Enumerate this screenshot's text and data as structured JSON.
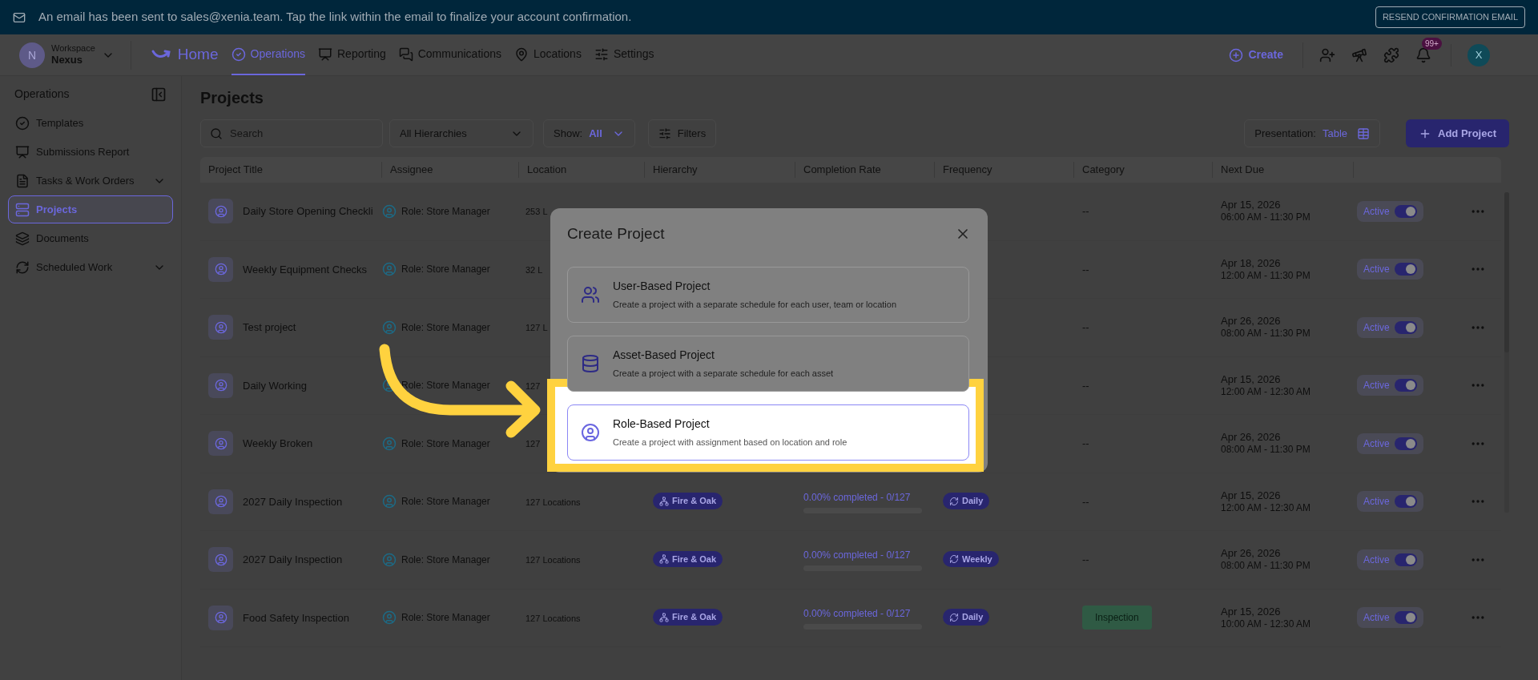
{
  "banner": {
    "message": "An email has been sent to sales@xenia.team. Tap the link within the email to finalize your account confirmation.",
    "button": "RESEND CONFIRMATION EMAIL"
  },
  "nav": {
    "workspace_label": "Workspace",
    "workspace_name": "Nexus",
    "workspace_initial": "N",
    "home": "Home",
    "tabs": [
      {
        "label": "Operations",
        "selected": true
      },
      {
        "label": "Reporting",
        "selected": false
      },
      {
        "label": "Communications",
        "selected": false
      },
      {
        "label": "Locations",
        "selected": false
      },
      {
        "label": "Settings",
        "selected": false
      }
    ],
    "create": "Create",
    "notification_badge": "99+",
    "avatar_initial": "X"
  },
  "sidebar": {
    "title": "Operations",
    "items": [
      {
        "label": "Templates",
        "selected": false,
        "expandable": false
      },
      {
        "label": "Submissions Report",
        "selected": false,
        "expandable": false
      },
      {
        "label": "Tasks & Work Orders",
        "selected": false,
        "expandable": true
      },
      {
        "label": "Projects",
        "selected": true,
        "expandable": false
      },
      {
        "label": "Documents",
        "selected": false,
        "expandable": false
      },
      {
        "label": "Scheduled Work",
        "selected": false,
        "expandable": true
      }
    ]
  },
  "page": {
    "title": "Projects",
    "search_placeholder": "Search",
    "hierarchy_select": "All Hierarchies",
    "show_label": "Show:",
    "show_value": "All",
    "filters": "Filters",
    "presentation_label": "Presentation:",
    "presentation_value": "Table",
    "add_button": "Add Project"
  },
  "table": {
    "columns": [
      "Project Title",
      "Assignee",
      "Location",
      "Hierarchy",
      "Completion Rate",
      "Frequency",
      "Category",
      "Next Due"
    ],
    "rows": [
      {
        "title": "Daily Store Opening Checkli",
        "assignee": "Role: Store Manager",
        "location": "253 L",
        "due_date": "Apr 15, 2026",
        "due_time": "06:00 AM - 11:30 PM",
        "category": {
          "text": "--",
          "kind": "plain"
        },
        "status": "Active",
        "on": true
      },
      {
        "title": "Weekly Equipment Checks",
        "assignee": "Role: Store Manager",
        "location": "32 L",
        "due_date": "Apr 18, 2026",
        "due_time": "12:00 AM - 11:30 PM",
        "category": {
          "text": "--",
          "kind": "plain"
        },
        "status": "Active",
        "on": true
      },
      {
        "title": "Test project",
        "assignee": "Role: Store Manager",
        "location": "127 L",
        "due_date": "Apr 26, 2026",
        "due_time": "08:00 AM - 11:30 PM",
        "category": {
          "text": "--",
          "kind": "plain"
        },
        "status": "Active",
        "on": true
      },
      {
        "title": "Daily Working",
        "assignee": "Role: Store Manager",
        "location": "127",
        "due_date": "Apr 15, 2026",
        "due_time": "12:00 AM - 12:30 AM",
        "category": {
          "text": "--",
          "kind": "plain"
        },
        "status": "Active",
        "on": true
      },
      {
        "title": "Weekly Broken",
        "assignee": "Role: Store Manager",
        "location": "127",
        "due_date": "Apr 26, 2026",
        "due_time": "08:00 AM - 11:30 PM",
        "category": {
          "text": "--",
          "kind": "plain"
        },
        "status": "Active",
        "on": true
      },
      {
        "title": "2027 Daily Inspection",
        "assignee": "Role: Store Manager",
        "location": "127 Locations",
        "hierarchy": "Fire & Oak",
        "completion": "0.00% completed - 0/127",
        "level": 0,
        "frequency": "Daily",
        "category": {
          "text": "--",
          "kind": "plain"
        },
        "due_date": "Apr 15, 2026",
        "due_time": "12:00 AM - 12:30 AM",
        "status": "Active",
        "on": true
      },
      {
        "title": "2027 Daily Inspection",
        "assignee": "Role: Store Manager",
        "location": "127 Locations",
        "hierarchy": "Fire & Oak",
        "completion": "0.00% completed - 0/127",
        "level": 0,
        "frequency": "Weekly",
        "category": {
          "text": "--",
          "kind": "plain"
        },
        "due_date": "Apr 26, 2026",
        "due_time": "08:00 AM - 11:30 PM",
        "status": "Active",
        "on": true
      },
      {
        "title": "Food Safety Inspection",
        "assignee": "Role: Store Manager",
        "location": "127 Locations",
        "hierarchy": "Fire & Oak",
        "completion": "0.00% completed - 0/127",
        "level": 0,
        "frequency": "Daily",
        "category": {
          "text": "Inspection",
          "kind": "tag"
        },
        "due_date": "Apr 15, 2026",
        "due_time": "10:00 AM - 12:30 AM",
        "status": "Active",
        "on": true
      }
    ]
  },
  "modal": {
    "title": "Create Project",
    "options": [
      {
        "title": "User-Based Project",
        "description": "Create a project with a separate schedule for each user, team or location",
        "selected": false
      },
      {
        "title": "Asset-Based Project",
        "description": "Create a project with a separate schedule for each asset",
        "selected": false
      },
      {
        "title": "Role-Based Project",
        "description": "Create a project with assignment based on location and role",
        "selected": true
      }
    ]
  }
}
